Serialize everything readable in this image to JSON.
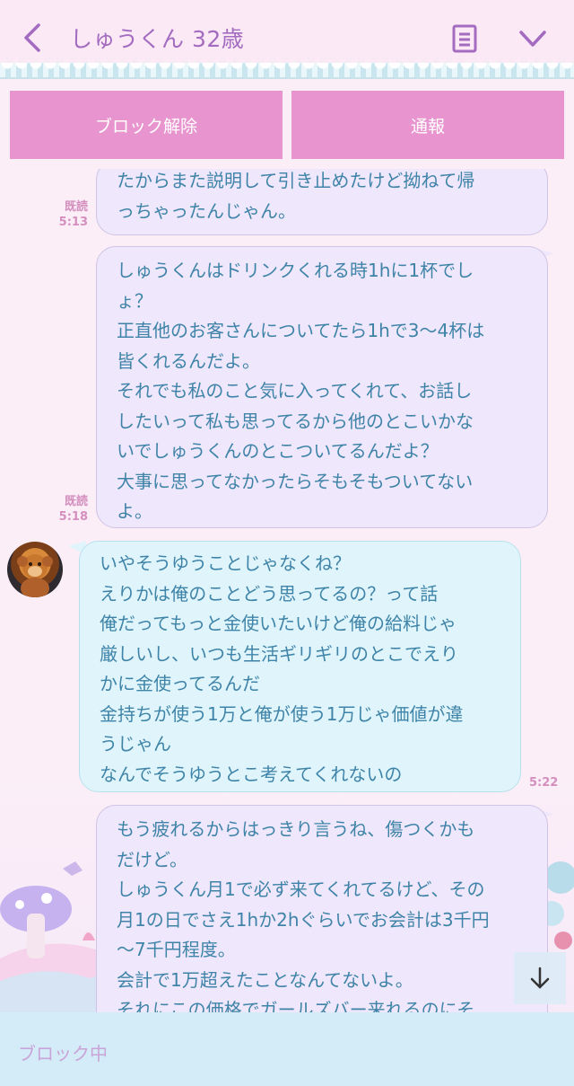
{
  "header": {
    "title": "しゅうくん 32歳",
    "back_icon": "chevron-left-icon",
    "note_icon": "note-icon",
    "menu_icon": "chevron-down-icon"
  },
  "actions": {
    "unblock_label": "ブロック解除",
    "report_label": "通報"
  },
  "messages": [
    {
      "sender": "me",
      "read": "既読",
      "time": "5:13",
      "text": "たからまた説明して引き止めたけど拗ねて帰\nっちゃったんじゃん。"
    },
    {
      "sender": "me",
      "read": "既読",
      "time": "5:18",
      "text": "しゅうくんはドリンクくれる時1hに1杯でし\nょ？\n正直他のお客さんについてたら1hで3〜4杯は\n皆くれるんだよ。\nそれでも私のこと気に入ってくれて、お話し\nしたいって私も思ってるから他のとこいかな\nいでしゅうくんのとこついてるんだよ？\n大事に思ってなかったらそもそもついてない\nよ。"
    },
    {
      "sender": "them",
      "time": "5:22",
      "text": "いやそうゆうことじゃなくね？\nえりかは俺のことどう思ってるの？って話\n俺だってもっと金使いたいけど俺の給料じゃ\n厳しいし、いつも生活ギリギリのとこでえり\nかに金使ってるんだ\n金持ちが使う1万と俺が使う1万じゃ価値が違\nうじゃん\nなんでそうゆうとこ考えてくれないの"
    },
    {
      "sender": "me",
      "text": "もう疲れるからはっきり言うね、傷つくかも\nだけど。\nしゅうくん月1で必ず来てくれてるけど、その\n月1の日でさえ1hか2hぐらいでお会計は3千円\n〜7千円程度。\n会計で1万超えたことなんてないよ。\nそれにこの価格でガールズバー来れるのにそ"
    }
  ],
  "footer": {
    "status_label": "ブロック中"
  },
  "colors": {
    "accent_pink": "#e895cf",
    "title_purple": "#a36cc0",
    "text_blue": "#3f84a8",
    "read_pink": "#d48fbf",
    "footer_blue": "#d4ecf8"
  },
  "scroll_icon": "arrow-down-icon"
}
